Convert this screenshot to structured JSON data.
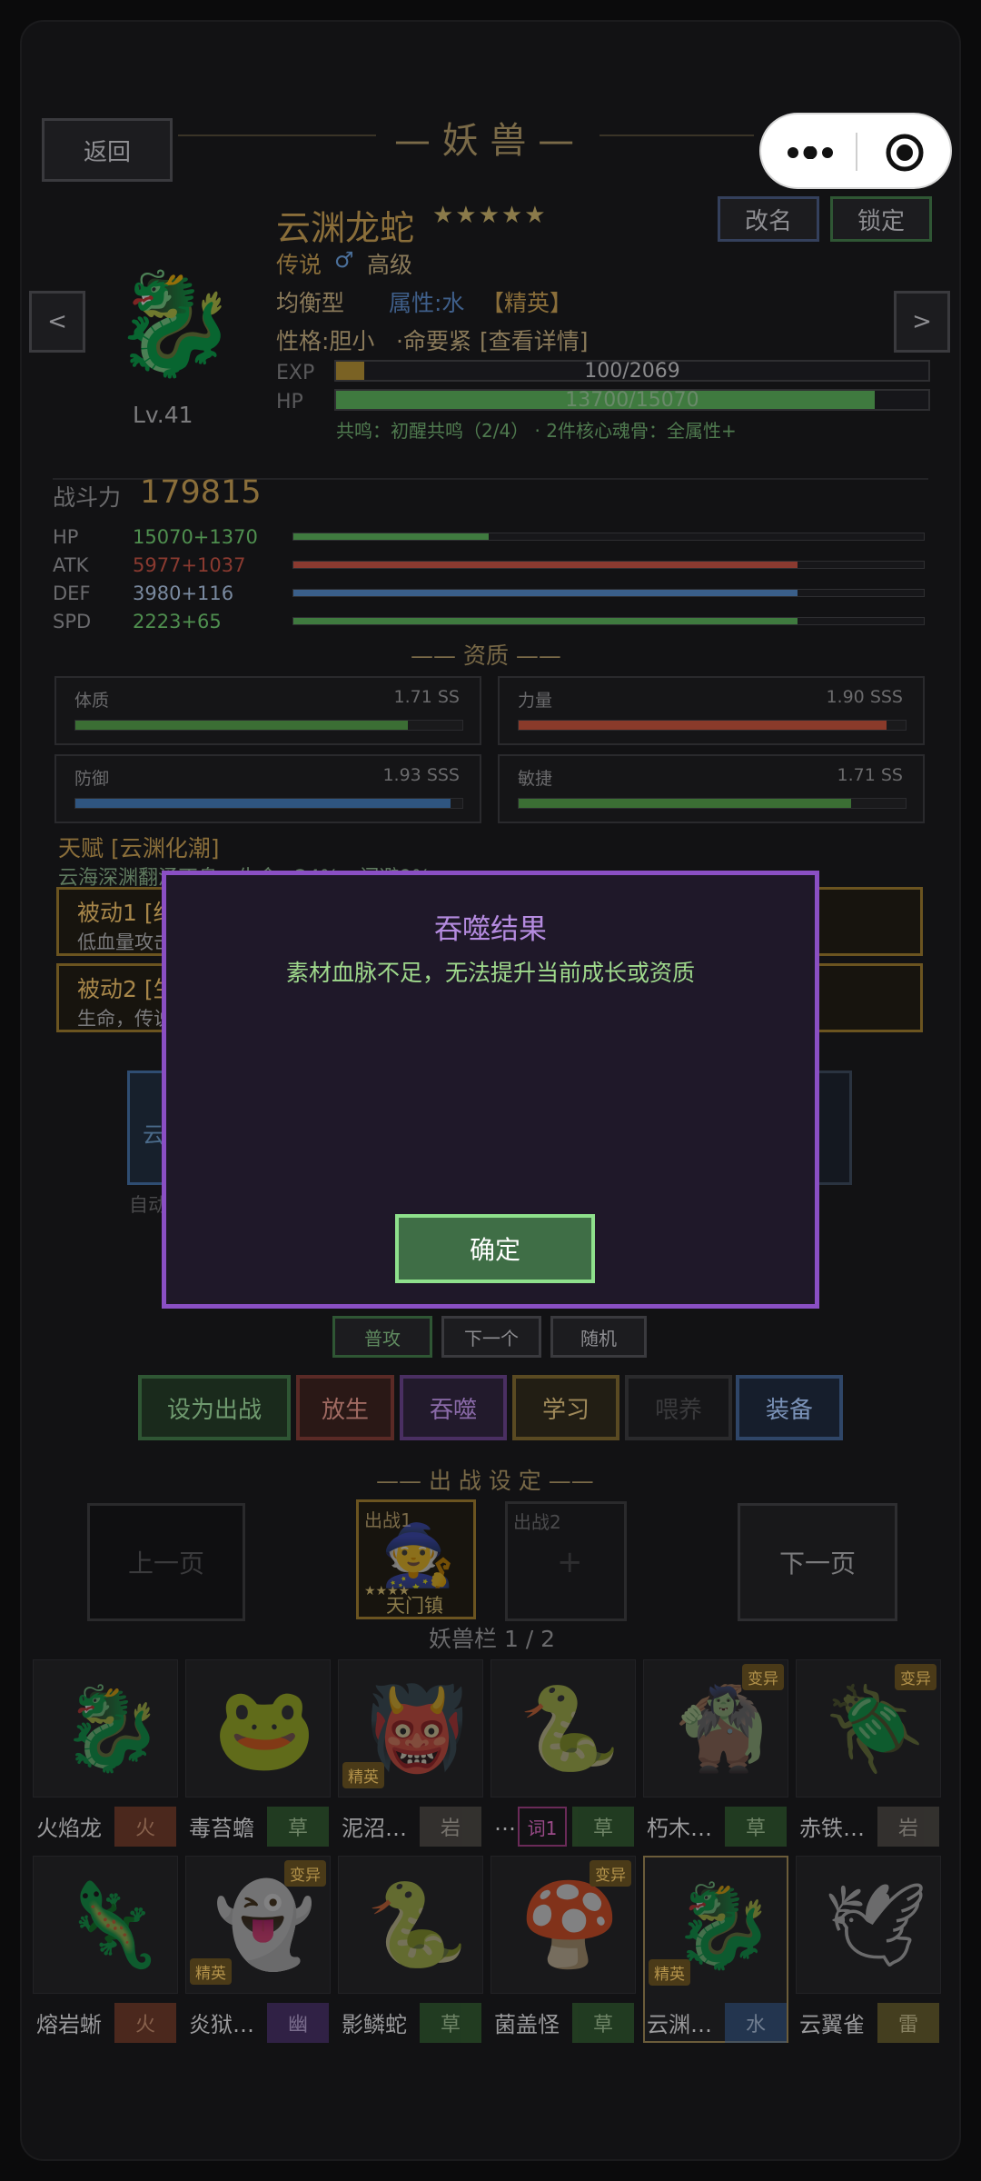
{
  "header": {
    "back_label": "返回",
    "title": "— 妖 兽 —",
    "rename_label": "改名",
    "lock_label": "锁定",
    "prev_label": "<",
    "next_label": ">"
  },
  "capsule": {
    "more_icon": "ellipsis-icon",
    "close_icon": "target-circle-icon"
  },
  "pet": {
    "name": "云渊龙蛇",
    "stars": "★★★★★",
    "rarity": "传说",
    "gender_symbol": "♂",
    "grade": "高级",
    "type": "均衡型",
    "attribute": "属性:水",
    "tag": "【精英】",
    "personality": "性格:胆小",
    "personality_detail": "·命要紧",
    "detail_link": "[查看详情]",
    "level": "Lv.41",
    "exp_label": "EXP",
    "exp_text": "100/2069",
    "exp_fraction": 0.048,
    "hp_label": "HP",
    "hp_text": "13700/15070",
    "hp_fraction": 0.909,
    "resonance": "共鸣：初醒共鸣（2/4） · 2件核心魂骨：全属性+"
  },
  "combat": {
    "power_label": "战斗力",
    "power_value": "179815",
    "stats": [
      {
        "label": "HP",
        "value": "15070+1370",
        "fraction": 0.31,
        "color": "#3f7a3f",
        "text_color": "#4f8f4f"
      },
      {
        "label": "ATK",
        "value": "5977+1037",
        "fraction": 0.8,
        "color": "#8a3a30",
        "text_color": "#8a3a30"
      },
      {
        "label": "DEF",
        "value": "3980+116",
        "fraction": 0.8,
        "color": "#3a5f8a",
        "text_color": "#7a8aa0"
      },
      {
        "label": "SPD",
        "value": "2223+65",
        "fraction": 0.8,
        "color": "#3f7a3f",
        "text_color": "#4f8f4f"
      }
    ]
  },
  "aptitude": {
    "title": "—— 资质 ——",
    "items": [
      {
        "name": "体质",
        "grade": "1.71 SS",
        "fraction": 0.86,
        "color": "#3b6e34"
      },
      {
        "name": "力量",
        "grade": "1.90 SSS",
        "fraction": 0.95,
        "color": "#8a3a2a"
      },
      {
        "name": "防御",
        "grade": "1.93 SSS",
        "fraction": 0.97,
        "color": "#2f5580"
      },
      {
        "name": "敏捷",
        "grade": "1.71 SS",
        "fraction": 0.86,
        "color": "#3b6e34"
      }
    ]
  },
  "talent": {
    "title": "天赋 [云渊化潮]",
    "desc": "云海深渊翻涌不息，生命+24%，闪避9%",
    "passive1_title": "被动1 [绝",
    "passive1_desc": "低血量攻击",
    "passive2_title": "被动2 [生",
    "passive2_desc": "生命，传说"
  },
  "skill_area": {
    "partial_label": "云",
    "auto_label": "自动"
  },
  "small_buttons": {
    "normal": "普攻",
    "next": "下一个",
    "random": "随机"
  },
  "actions": {
    "deploy": "设为出战",
    "release": "放生",
    "devour": "吞噬",
    "learn": "学习",
    "feed": "喂养",
    "equip": "装备"
  },
  "battle": {
    "title": "—— 出 战 设 定 ——",
    "prev_page": "上一页",
    "next_page": "下一页",
    "slot1_label": "出战1",
    "slot1_pet": "天门镇",
    "slot1_stars": "★★★★",
    "slot2_label": "出战2",
    "slot2_plus": "+"
  },
  "bag": {
    "title": "妖兽栏 1 / 2",
    "row1": [
      {
        "name": "火焰龙",
        "elem": "火",
        "elem_color": "#7a3a26",
        "elem_text": "#e8a27a",
        "icon": "🐉"
      },
      {
        "name": "毒苔蟾",
        "elem": "草",
        "elem_color": "#2f5e2c",
        "elem_text": "#b8e0a8",
        "icon": "🐸"
      },
      {
        "name": "泥沼…",
        "elem": "岩",
        "elem_color": "#4e4a44",
        "elem_text": "#c9c2b4",
        "icon": "👹",
        "badge": "精英"
      },
      {
        "name": "…",
        "elem": "草",
        "elem_color": "#2f5e2c",
        "elem_text": "#b8e0a8",
        "icon": "🐍",
        "chip": "词1"
      },
      {
        "name": "朽木…",
        "elem": "草",
        "elem_color": "#2f5e2c",
        "elem_text": "#b8e0a8",
        "icon": "🧌",
        "badge_top": "变异"
      },
      {
        "name": "赤铁…",
        "elem": "岩",
        "elem_color": "#4e4a44",
        "elem_text": "#c9c2b4",
        "icon": "🪲",
        "badge_top": "变异"
      }
    ],
    "row2": [
      {
        "name": "熔岩蜥",
        "elem": "火",
        "elem_color": "#7a3a26",
        "elem_text": "#e8a27a",
        "icon": "🦎"
      },
      {
        "name": "炎狱…",
        "elem": "幽",
        "elem_color": "#4a2f6e",
        "elem_text": "#d0b8f0",
        "icon": "👻",
        "badge": "精英",
        "badge_top": "变异"
      },
      {
        "name": "影鳞蛇",
        "elem": "草",
        "elem_color": "#2f5e2c",
        "elem_text": "#b8e0a8",
        "icon": "🐍"
      },
      {
        "name": "菌盖怪",
        "elem": "草",
        "elem_color": "#2f5e2c",
        "elem_text": "#b8e0a8",
        "icon": "🍄",
        "badge_top": "变异"
      },
      {
        "name": "云渊…",
        "elem": "水",
        "elem_color": "#2c4d7a",
        "elem_text": "#b8d0f0",
        "icon": "🐉",
        "badge": "精英"
      },
      {
        "name": "云翼雀",
        "elem": "雷",
        "elem_color": "#6e6228",
        "elem_text": "#e8dca0",
        "icon": "🕊"
      }
    ]
  },
  "modal": {
    "title": "吞噬结果",
    "message": "素材血脉不足，无法提升当前成长或资质",
    "confirm_label": "确定"
  }
}
